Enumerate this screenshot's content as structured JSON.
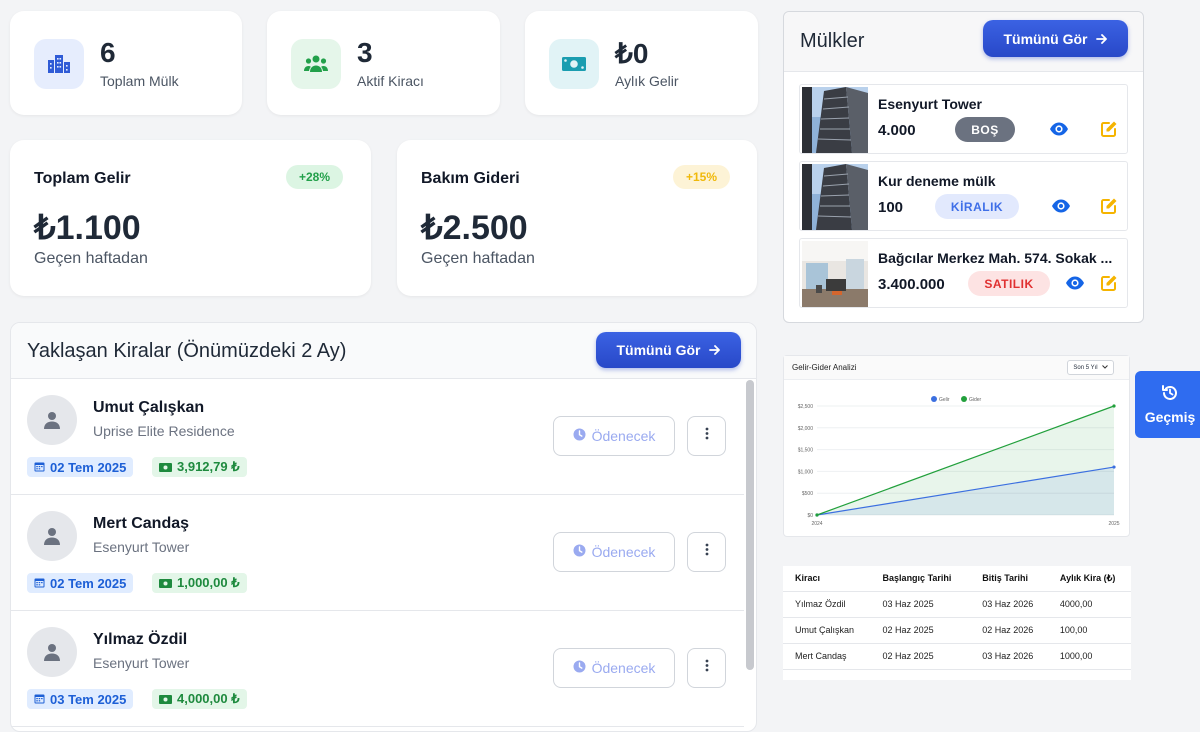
{
  "stats": [
    {
      "value": "6",
      "label": "Toplam Mülk",
      "icon": "building-icon"
    },
    {
      "value": "3",
      "label": "Aktif Kiracı",
      "icon": "users-icon"
    },
    {
      "value": "₺0",
      "label": "Aylık Gelir",
      "icon": "money-icon"
    }
  ],
  "finance": [
    {
      "title": "Toplam Gelir",
      "badge": "+28%",
      "amount": "₺1.100",
      "sub": "Geçen haftadan"
    },
    {
      "title": "Bakım Gideri",
      "badge": "+15%",
      "amount": "₺2.500",
      "sub": "Geçen haftadan"
    }
  ],
  "upcoming": {
    "title": "Yaklaşan Kiralar (Önümüzdeki 2 Ay)",
    "view_all": "Tümünü Gör",
    "items": [
      {
        "name": "Umut Çalışkan",
        "property": "Uprise Elite Residence",
        "date": "02 Tem 2025",
        "amount": "3,912,79 ₺",
        "status": "Ödenecek"
      },
      {
        "name": "Mert Candaş",
        "property": "Esenyurt Tower",
        "date": "02 Tem 2025",
        "amount": "1,000,00 ₺",
        "status": "Ödenecek"
      },
      {
        "name": "Yılmaz Özdil",
        "property": "Esenyurt Tower",
        "date": "03 Tem 2025",
        "amount": "4,000,00 ₺",
        "status": "Ödenecek"
      }
    ]
  },
  "properties": {
    "title": "Mülkler",
    "view_all": "Tümünü Gör",
    "items": [
      {
        "name": "Esenyurt Tower",
        "price": "4.000",
        "status": "BOŞ"
      },
      {
        "name": "Kur deneme mülk",
        "price": "100",
        "status": "KİRALIK"
      },
      {
        "name": "Bağcılar Merkez Mah. 574. Sokak ...",
        "price": "3.400.000",
        "status": "SATILIK"
      }
    ]
  },
  "chart": {
    "title": "Gelir-Gider Analizi",
    "period": "Son 5 Yıl",
    "colors": {
      "income": "#3b6fe0",
      "expense": "#22a03c"
    }
  },
  "chart_data": {
    "type": "line",
    "x": [
      "2024",
      "2025"
    ],
    "series": [
      {
        "name": "Gelir",
        "values": [
          0,
          1100
        ]
      },
      {
        "name": "Gider",
        "values": [
          0,
          2500
        ]
      }
    ],
    "yticks": [
      "$0",
      "$500",
      "$1,000",
      "$1,500",
      "$2,000",
      "$2,500"
    ],
    "ylim": [
      0,
      2500
    ],
    "legend": "top"
  },
  "rent_table": {
    "headers": [
      "Kiracı",
      "Başlangıç Tarihi",
      "Bitiş Tarihi",
      "Aylık Kira (₺)"
    ],
    "rows": [
      [
        "Yılmaz Özdil",
        "03 Haz 2025",
        "03 Haz 2026",
        "4000,00"
      ],
      [
        "Umut Çalışkan",
        "02 Haz 2025",
        "02 Haz 2026",
        "100,00"
      ],
      [
        "Mert Candaş",
        "02 Haz 2025",
        "03 Haz 2026",
        "1000,00"
      ]
    ]
  },
  "history_button": "Geçmiş"
}
